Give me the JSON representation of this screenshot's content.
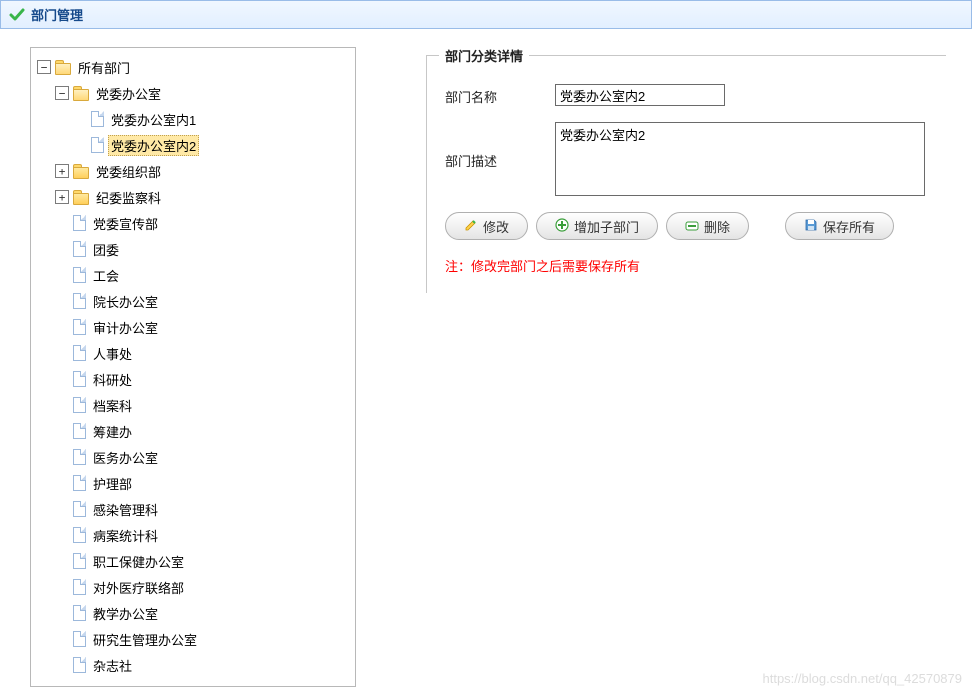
{
  "header": {
    "title": "部门管理"
  },
  "tree": {
    "root": "所有部门",
    "nodes": [
      {
        "label": "党委办公室",
        "type": "folder",
        "state": "open",
        "depth": 1
      },
      {
        "label": "党委办公室内1",
        "type": "doc",
        "depth": 2
      },
      {
        "label": "党委办公室内2",
        "type": "doc",
        "depth": 2,
        "selected": true
      },
      {
        "label": "党委组织部",
        "type": "folder",
        "state": "closed",
        "depth": 1
      },
      {
        "label": "纪委监察科",
        "type": "folder",
        "state": "closed",
        "depth": 1
      },
      {
        "label": "党委宣传部",
        "type": "doc",
        "depth": 1
      },
      {
        "label": "团委",
        "type": "doc",
        "depth": 1
      },
      {
        "label": "工会",
        "type": "doc",
        "depth": 1
      },
      {
        "label": "院长办公室",
        "type": "doc",
        "depth": 1
      },
      {
        "label": "审计办公室",
        "type": "doc",
        "depth": 1
      },
      {
        "label": "人事处",
        "type": "doc",
        "depth": 1
      },
      {
        "label": "科研处",
        "type": "doc",
        "depth": 1
      },
      {
        "label": "档案科",
        "type": "doc",
        "depth": 1
      },
      {
        "label": "筹建办",
        "type": "doc",
        "depth": 1
      },
      {
        "label": "医务办公室",
        "type": "doc",
        "depth": 1
      },
      {
        "label": "护理部",
        "type": "doc",
        "depth": 1
      },
      {
        "label": "感染管理科",
        "type": "doc",
        "depth": 1
      },
      {
        "label": "病案统计科",
        "type": "doc",
        "depth": 1
      },
      {
        "label": "职工保健办公室",
        "type": "doc",
        "depth": 1
      },
      {
        "label": "对外医疗联络部",
        "type": "doc",
        "depth": 1
      },
      {
        "label": "教学办公室",
        "type": "doc",
        "depth": 1
      },
      {
        "label": "研究生管理办公室",
        "type": "doc",
        "depth": 1
      },
      {
        "label": "杂志社",
        "type": "doc",
        "depth": 1
      }
    ]
  },
  "detail": {
    "legend": "部门分类详情",
    "name_label": "部门名称",
    "name_value": "党委办公室内2",
    "desc_label": "部门描述",
    "desc_value": "党委办公室内2",
    "buttons": {
      "edit": "修改",
      "add_child": "增加子部门",
      "delete": "删除",
      "save_all": "保存所有"
    },
    "note": "注：修改完部门之后需要保存所有"
  },
  "watermark": "https://blog.csdn.net/qq_42570879"
}
